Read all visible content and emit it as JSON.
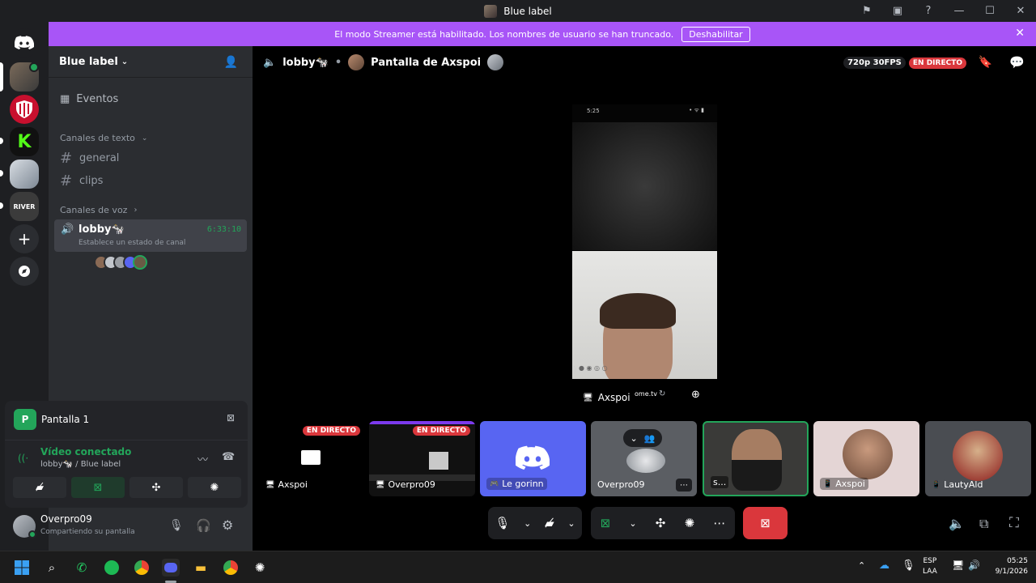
{
  "titlebar": {
    "title": "Blue label"
  },
  "banner": {
    "text": "El modo Streamer está habilitado. Los nombres de usuario se han truncado.",
    "button": "Deshabilitar"
  },
  "server": {
    "name": "Blue label"
  },
  "nav": {
    "events": "Eventos",
    "text_category": "Canales de texto",
    "text_channels": [
      "general",
      "clips"
    ],
    "voice_category": "Canales de voz",
    "voice_channel": {
      "name": "lobby🐄",
      "time": "6:33:10",
      "status": "Establece un estado de canal"
    }
  },
  "screen_panel": {
    "title": "Pantalla 1"
  },
  "voice_status": {
    "title": "Vídeo conectado",
    "subtitle": "lobby🐄 / Blue label"
  },
  "user": {
    "name": "Overpro09",
    "status": "Compartiendo su pantalla"
  },
  "header": {
    "channel": "lobby🐄",
    "stream_title": "Pantalla de Axspoi",
    "quality": "720p 30FPS",
    "live_badge": "EN DIRECTO"
  },
  "stage": {
    "label": "Axspoi",
    "overlay_text": "ome.tv",
    "status_time": "5:25"
  },
  "tiles": [
    {
      "label": "Axspoi",
      "badge": "EN DIRECTO"
    },
    {
      "label": "Overpro09",
      "badge": "EN DIRECTO"
    },
    {
      "label": "Le gorinn"
    },
    {
      "label": "Overpro09"
    },
    {
      "label": "s..."
    },
    {
      "label": "Axspoi"
    },
    {
      "label": "LautyAld"
    }
  ],
  "taskbar": {
    "lang": "ESP",
    "region": "LAA",
    "time": "05:25",
    "date": "9/1/2026"
  },
  "colors": {
    "brand": "#5865f2",
    "streamer_banner": "#a855f7",
    "live": "#da373c",
    "online": "#23a55a"
  }
}
